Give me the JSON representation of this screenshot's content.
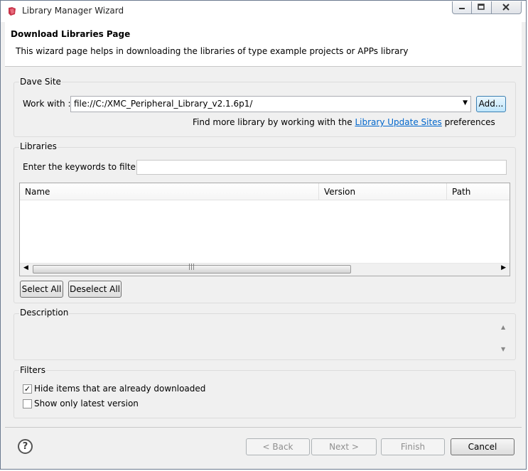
{
  "window": {
    "title": "Library Manager Wizard"
  },
  "header": {
    "title": "Download Libraries Page",
    "description": "This wizard page helps in downloading the libraries of type example projects or APPs library"
  },
  "dave_site": {
    "group_label": "Dave Site",
    "work_with_label": "Work with :",
    "work_with_value": "file://C:/XMC_Peripheral_Library_v2.1.6p1/",
    "add_button": "Add...",
    "find_more_prefix": "Find more library by working with the",
    "find_more_link": "Library Update Sites",
    "find_more_suffix": "preferences"
  },
  "libraries": {
    "group_label": "Libraries",
    "filter_label": "Enter the keywords to filter :",
    "filter_value": "",
    "columns": [
      "Name",
      "Version",
      "Path"
    ],
    "rows": [],
    "select_all": "Select All",
    "deselect_all": "Deselect All"
  },
  "description": {
    "group_label": "Description",
    "text": ""
  },
  "filters": {
    "group_label": "Filters",
    "hide_downloaded": {
      "label": "Hide items that are already downloaded",
      "checked": true
    },
    "latest_only": {
      "label": "Show only latest version",
      "checked": false
    }
  },
  "footer": {
    "help": "?",
    "back": "< Back",
    "next": "Next >",
    "finish": "Finish",
    "cancel": "Cancel"
  },
  "colors": {
    "link": "#0066cc",
    "accent": "#3c7fb1"
  }
}
